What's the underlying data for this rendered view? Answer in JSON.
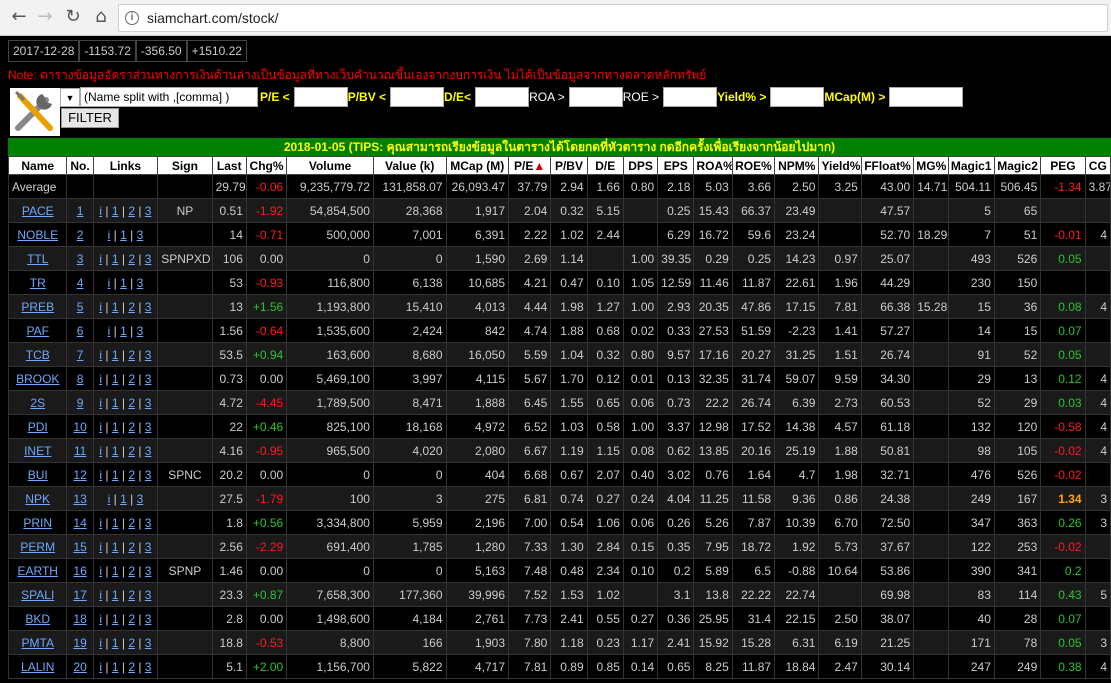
{
  "browser": {
    "url": "siamchart.com/stock/"
  },
  "index": {
    "date": "2017-12-28",
    "v1": "-1153.72",
    "v2": "-356.50",
    "v3": "+1510.22"
  },
  "note": "Note: ตารางข้อมูลอัตราส่วนทางการเงินด้านล่างเป็นข้อมูลที่ทางเว็บคำนวณขึ้นเองจากงบการเงิน ไม่ได้เป็นข้อมูลจากทางตลาดหลักทรัพย์",
  "filter": {
    "name_value": "(Name split with ,[comma] )",
    "pe_label": "P/E <",
    "pbv_label": "P/BV <",
    "de_label": "D/E<",
    "roa_label": "ROA >",
    "roe_label": "ROE >",
    "yield_label": "Yield% >",
    "mcap_label": "MCap(M) >",
    "button": "FILTER"
  },
  "banner": "2018-01-05 (TIPS: คุณสามารถเรียงข้อมูลในตารางได้โดยกดที่หัวตาราง กดอีกครั้งเพื่อเรียงจากน้อยไปมาก)",
  "columns": [
    "Name",
    "No.",
    "Links",
    "Sign",
    "Last",
    "Chg%",
    "Volume",
    "Value (k)",
    "MCap (M)",
    "P/E",
    "P/BV",
    "D/E",
    "DPS",
    "EPS",
    "ROA%",
    "ROE%",
    "NPM%",
    "Yield%",
    "FFloat%",
    "MG%",
    "Magic1",
    "Magic2",
    "PEG",
    "CG"
  ],
  "average": [
    "Average",
    "",
    "",
    "",
    "29.79",
    "-0.06",
    "9,235,779.72",
    "131,858.07",
    "26,093.47",
    "37.79",
    "2.94",
    "1.66",
    "0.80",
    "2.18",
    "5.03",
    "3.66",
    "2.50",
    "3.25",
    "43.00",
    "14.71",
    "504.11",
    "506.45",
    "-1.34",
    "3.87"
  ],
  "rows": [
    [
      "PACE",
      "1",
      "i | 1 | 2 | 3",
      "NP",
      "0.51",
      "-1.92",
      "54,854,500",
      "28,368",
      "1,917",
      "2.04",
      "0.32",
      "5.15",
      "",
      "0.25",
      "15.43",
      "66.37",
      "23.49",
      "",
      "47.57",
      "",
      "5",
      "65",
      "",
      ""
    ],
    [
      "NOBLE",
      "2",
      "i | 1 | 3",
      "",
      "14",
      "-0.71",
      "500,000",
      "7,001",
      "6,391",
      "2.22",
      "1.02",
      "2.44",
      "",
      "6.29",
      "16.72",
      "59.6",
      "23.24",
      "",
      "52.70",
      "18.29",
      "7",
      "51",
      "-0.01",
      "4"
    ],
    [
      "TTL",
      "3",
      "i | 1 | 2 | 3",
      "SPNPXD",
      "106",
      "0.00",
      "0",
      "0",
      "1,590",
      "2.69",
      "1.14",
      "",
      "1.00",
      "39.35",
      "0.29",
      "0.25",
      "14.23",
      "0.97",
      "25.07",
      "",
      "493",
      "526",
      "0.05",
      ""
    ],
    [
      "TR",
      "4",
      "i | 1 | 3",
      "",
      "53",
      "-0.93",
      "116,800",
      "6,138",
      "10,685",
      "4.21",
      "0.47",
      "0.10",
      "1.05",
      "12.59",
      "11.46",
      "11.87",
      "22.61",
      "1.96",
      "44.29",
      "",
      "230",
      "150",
      "",
      ""
    ],
    [
      "PREB",
      "5",
      "i | 1 | 2 | 3",
      "",
      "13",
      "+1.56",
      "1,193,800",
      "15,410",
      "4,013",
      "4.44",
      "1.98",
      "1.27",
      "1.00",
      "2.93",
      "20.35",
      "47.86",
      "17.15",
      "7.81",
      "66.38",
      "15.28",
      "15",
      "36",
      "0.08",
      "4"
    ],
    [
      "PAF",
      "6",
      "i | 1 | 3",
      "",
      "1.56",
      "-0.64",
      "1,535,600",
      "2,424",
      "842",
      "4.74",
      "1.88",
      "0.68",
      "0.02",
      "0.33",
      "27.53",
      "51.59",
      "-2.23",
      "1.41",
      "57.27",
      "",
      "14",
      "15",
      "0.07",
      ""
    ],
    [
      "TCB",
      "7",
      "i | 1 | 2 | 3",
      "",
      "53.5",
      "+0.94",
      "163,600",
      "8,680",
      "16,050",
      "5.59",
      "1.04",
      "0.32",
      "0.80",
      "9.57",
      "17.16",
      "20.27",
      "31.25",
      "1.51",
      "26.74",
      "",
      "91",
      "52",
      "0.05",
      ""
    ],
    [
      "BROOK",
      "8",
      "i | 1 | 2 | 3",
      "",
      "0.73",
      "0.00",
      "5,469,100",
      "3,997",
      "4,115",
      "5.67",
      "1.70",
      "0.12",
      "0.01",
      "0.13",
      "32.35",
      "31.74",
      "59.07",
      "9.59",
      "34.30",
      "",
      "29",
      "13",
      "0.12",
      "4"
    ],
    [
      "2S",
      "9",
      "i | 1 | 2 | 3",
      "",
      "4.72",
      "-4.45",
      "1,789,500",
      "8,471",
      "1,888",
      "6.45",
      "1.55",
      "0.65",
      "0.06",
      "0.73",
      "22.2",
      "26.74",
      "6.39",
      "2.73",
      "60.53",
      "",
      "52",
      "29",
      "0.03",
      "4"
    ],
    [
      "PDI",
      "10",
      "i | 1 | 2 | 3",
      "",
      "22",
      "+0.46",
      "825,100",
      "18,168",
      "4,972",
      "6.52",
      "1.03",
      "0.58",
      "1.00",
      "3.37",
      "12.98",
      "17.52",
      "14.38",
      "4.57",
      "61.18",
      "",
      "132",
      "120",
      "-0.58",
      "4"
    ],
    [
      "INET",
      "11",
      "i | 1 | 2 | 3",
      "",
      "4.16",
      "-0.95",
      "965,500",
      "4,020",
      "2,080",
      "6.67",
      "1.19",
      "1.15",
      "0.08",
      "0.62",
      "13.85",
      "20.16",
      "25.19",
      "1.88",
      "50.81",
      "",
      "98",
      "105",
      "-0.02",
      "4"
    ],
    [
      "BUI",
      "12",
      "i | 1 | 2 | 3",
      "SPNC",
      "20.2",
      "0.00",
      "0",
      "0",
      "404",
      "6.68",
      "0.67",
      "2.07",
      "0.40",
      "3.02",
      "0.76",
      "1.64",
      "4.7",
      "1.98",
      "32.71",
      "",
      "476",
      "526",
      "-0.02",
      ""
    ],
    [
      "NPK",
      "13",
      "i | 1 | 3",
      "",
      "27.5",
      "-1.79",
      "100",
      "3",
      "275",
      "6.81",
      "0.74",
      "0.27",
      "0.24",
      "4.04",
      "11.25",
      "11.58",
      "9.36",
      "0.86",
      "24.38",
      "",
      "249",
      "167",
      "1.34",
      "3"
    ],
    [
      "PRIN",
      "14",
      "i | 1 | 2 | 3",
      "",
      "1.8",
      "+0.56",
      "3,334,800",
      "5,959",
      "2,196",
      "7.00",
      "0.54",
      "1.06",
      "0.06",
      "0.26",
      "5.26",
      "7.87",
      "10.39",
      "6.70",
      "72.50",
      "",
      "347",
      "363",
      "0.26",
      "3"
    ],
    [
      "PERM",
      "15",
      "i | 1 | 2 | 3",
      "",
      "2.56",
      "-2.29",
      "691,400",
      "1,785",
      "1,280",
      "7.33",
      "1.30",
      "2.84",
      "0.15",
      "0.35",
      "7.95",
      "18.72",
      "1.92",
      "5.73",
      "37.67",
      "",
      "122",
      "253",
      "-0.02",
      ""
    ],
    [
      "EARTH",
      "16",
      "i | 1 | 2 | 3",
      "SPNP",
      "1.46",
      "0.00",
      "0",
      "0",
      "5,163",
      "7.48",
      "0.48",
      "2.34",
      "0.10",
      "0.2",
      "5.89",
      "6.5",
      "-0.88",
      "10.64",
      "53.86",
      "",
      "390",
      "341",
      "0.2",
      ""
    ],
    [
      "SPALI",
      "17",
      "i | 1 | 2 | 3",
      "",
      "23.3",
      "+0.87",
      "7,658,300",
      "177,360",
      "39,996",
      "7.52",
      "1.53",
      "1.02",
      "",
      "3.1",
      "13.8",
      "22.22",
      "22.74",
      "",
      "69.98",
      "",
      "83",
      "114",
      "0.43",
      "5"
    ],
    [
      "BKD",
      "18",
      "i | 1 | 2 | 3",
      "",
      "2.8",
      "0.00",
      "1,498,600",
      "4,184",
      "2,761",
      "7.73",
      "2.41",
      "0.55",
      "0.27",
      "0.36",
      "25.95",
      "31.4",
      "22.15",
      "2.50",
      "38.07",
      "",
      "40",
      "28",
      "0.07",
      ""
    ],
    [
      "PMTA",
      "19",
      "i | 1 | 2 | 3",
      "",
      "18.8",
      "-0.53",
      "8,800",
      "166",
      "1,903",
      "7.80",
      "1.18",
      "0.23",
      "1.17",
      "2.41",
      "15.92",
      "15.28",
      "6.31",
      "6.19",
      "21.25",
      "",
      "171",
      "78",
      "0.05",
      "3"
    ],
    [
      "LALIN",
      "20",
      "i | 1 | 2 | 3",
      "",
      "5.1",
      "+2.00",
      "1,156,700",
      "5,822",
      "4,717",
      "7.81",
      "0.89",
      "0.85",
      "0.14",
      "0.65",
      "8.25",
      "11.87",
      "18.84",
      "2.47",
      "30.14",
      "",
      "247",
      "249",
      "0.38",
      "4"
    ]
  ]
}
